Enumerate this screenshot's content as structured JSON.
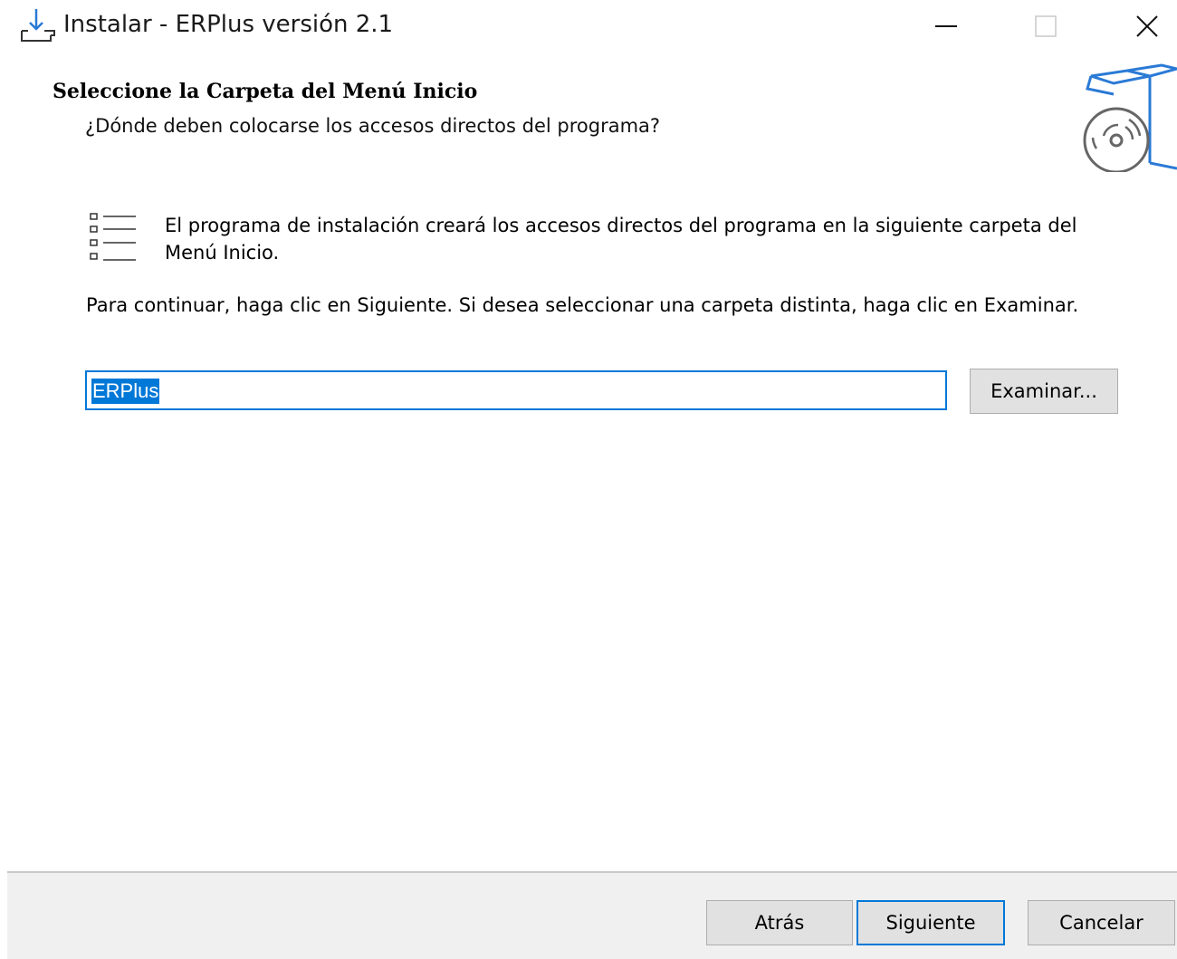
{
  "window": {
    "title": "Instalar - ERPlus versión 2.1"
  },
  "header": {
    "title": "Seleccione la Carpeta del Menú Inicio",
    "subtitle": "¿Dónde deben colocarse los accesos directos del programa?"
  },
  "body": {
    "info": "El programa de instalación creará los accesos directos del programa en la siguiente carpeta del Menú Inicio.",
    "continue": "Para continuar, haga clic en Siguiente. Si desea seleccionar una carpeta distinta, haga clic en Examinar."
  },
  "folder": {
    "value": "ERPlus",
    "browse_label": "Examinar..."
  },
  "buttons": {
    "back": "Atrás",
    "next": "Siguiente",
    "cancel": "Cancelar"
  },
  "colors": {
    "accent": "#0078d7",
    "footer_bg": "#f0f0f0",
    "button_bg": "#e1e1e1"
  },
  "icons": {
    "app": "install-icon",
    "wizard": "box-disc-icon",
    "list": "list-icon",
    "minimize": "minimize-icon",
    "maximize": "maximize-icon",
    "close": "close-icon"
  }
}
